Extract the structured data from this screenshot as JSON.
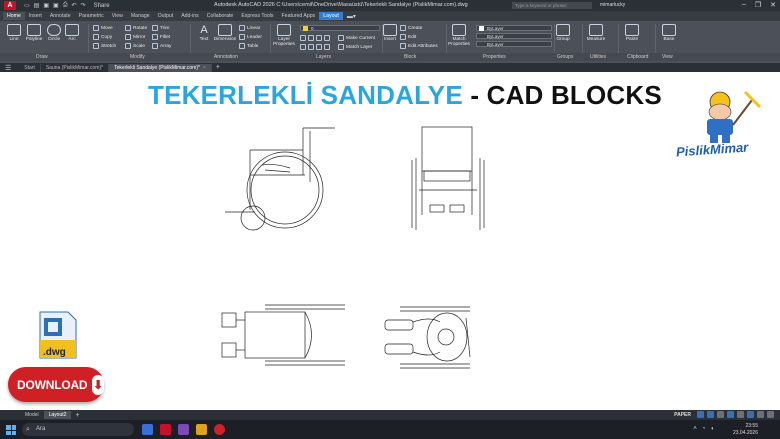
{
  "titlebar": {
    "app_logo": "A",
    "share": "Share",
    "title": "Autodesk AutoCAD 2026   C:\\Users\\cemil\\OneDrive\\Masaüstü\\Tekerlekli Sandalye (PislikMimar.com).dwg",
    "search_placeholder": "Type a keyword or phrase",
    "user": "mimarlucky"
  },
  "ribbon_tabs": [
    "Home",
    "Insert",
    "Annotate",
    "Parametric",
    "View",
    "Manage",
    "Output",
    "Add-ins",
    "Collaborate",
    "Express Tools",
    "Featured Apps",
    "Layout"
  ],
  "ribbon": {
    "draw": {
      "line": "Line",
      "polyline": "Polyline",
      "circle": "Circle",
      "arc": "Arc"
    },
    "modify": {
      "move": "Move",
      "rotate": "Rotate",
      "trim": "Trim",
      "copy": "Copy",
      "mirror": "Mirror",
      "fillet": "Fillet",
      "stretch": "Stretch",
      "scale": "Scale",
      "array": "Array"
    },
    "annotation": {
      "text": "Text",
      "dimension": "Dimension",
      "linear": "Linear",
      "leader": "Leader",
      "table": "Table"
    },
    "layers": {
      "layer_properties": "Layer Properties",
      "make_current": "Make Current",
      "match_layer": "Match Layer",
      "layer_value": "0"
    },
    "block": {
      "insert": "Insert",
      "create": "Create",
      "edit": "Edit",
      "edit_attributes": "Edit Attributes"
    },
    "properties": {
      "match_properties": "Match Properties",
      "bylayer_1": "ByLayer",
      "bylayer_2": "ByLayer",
      "bylayer_3": "ByLayer"
    },
    "groups": {
      "group": "Group"
    },
    "utilities": {
      "measure": "Measure"
    },
    "clipboard": {
      "paste": "Paste"
    },
    "view": {
      "base": "Base"
    },
    "panel_labels": {
      "draw": "Draw",
      "modify": "Modify",
      "annotation": "Annotation",
      "layers": "Layers",
      "block": "Block",
      "properties": "Properties",
      "groups": "Groups",
      "utilities": "Utilities",
      "clipboard": "Clipboard",
      "view": "View"
    }
  },
  "doc_tabs": {
    "start": "Start",
    "tab1": "Sauna (PislikMimar.com)*",
    "tab2": "Tekerlekli Sandalye (PislikMimar.com)*"
  },
  "canvas": {
    "title_part1": "TEKERLEKLİ SANDALYE",
    "title_part2": "- CAD BLOCKS",
    "dwg_label": ".dwg",
    "download_label": "DOWNLOAD",
    "brand": "PislikMimar"
  },
  "layout_tabs": {
    "model": "Model",
    "layout2": "Layout2"
  },
  "status": {
    "paper": "PAPER"
  },
  "taskbar": {
    "search": "Ara",
    "time": "23:55",
    "date": "23.04.2026"
  },
  "colors": {
    "title_blue": "#29a6e0",
    "download_red": "#d11f26",
    "ribbon_bg": "#4c5159",
    "layout_tab": "#2e7fd4"
  }
}
